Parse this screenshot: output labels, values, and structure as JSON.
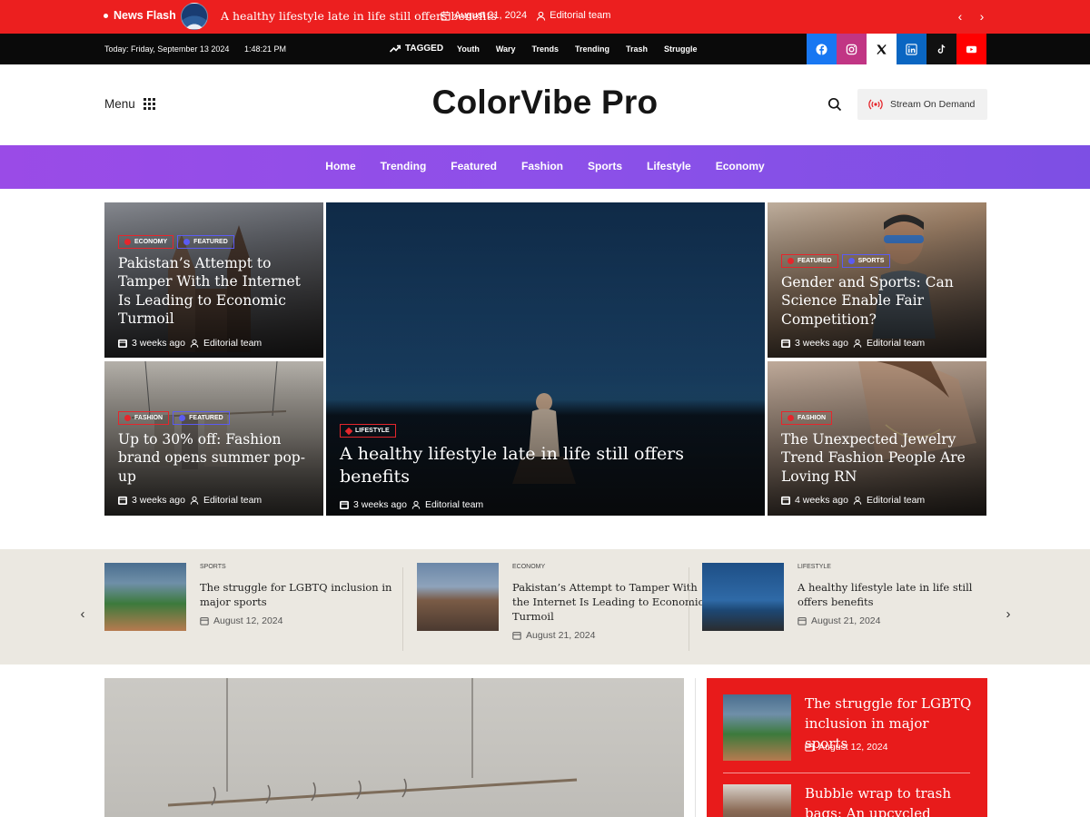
{
  "news_flash": {
    "label": "News Flash",
    "headline": "A healthy lifestyle late in life still offers benefits",
    "date": "August 21, 2024",
    "author": "Editorial team",
    "prev_glyph": "‹",
    "next_glyph": "›"
  },
  "topbar": {
    "date": "Today: Friday, September 13 2024",
    "time": "1:48:21 PM",
    "tagged_label": "TAGGED",
    "tags": [
      "Youth",
      "Wary",
      "Trends",
      "Trending",
      "Trash",
      "Struggle"
    ],
    "socials": [
      {
        "name": "facebook-icon",
        "color": "#1877f2"
      },
      {
        "name": "instagram-icon",
        "color": "#c13584"
      },
      {
        "name": "x-icon",
        "color": "#ffffff"
      },
      {
        "name": "linkedin-icon",
        "color": "#0a66c2"
      },
      {
        "name": "tiktok-icon",
        "color": "#111111"
      },
      {
        "name": "youtube-icon",
        "color": "#ff0000"
      }
    ]
  },
  "header": {
    "menu_label": "Menu",
    "site_title": "ColorVibe Pro",
    "stream_label": "Stream On Demand"
  },
  "nav": {
    "items": [
      "Home",
      "Trending",
      "Featured",
      "Fashion",
      "Sports",
      "Lifestyle",
      "Economy"
    ]
  },
  "hero": {
    "tl": {
      "badges": [
        "ECONOMY",
        "FEATURED"
      ],
      "title": "Pakistan’s Attempt to Tamper With the Internet Is Leading to Economic Turmoil",
      "time": "3 weeks ago",
      "author": "Editorial team"
    },
    "bl": {
      "badges": [
        "FASHION",
        "FEATURED"
      ],
      "title": "Up to 30% off: Fashion brand opens summer pop-up",
      "time": "3 weeks ago",
      "author": "Editorial team"
    },
    "center": {
      "badges": [
        "LIFESTYLE"
      ],
      "title": "A healthy lifestyle late in life still offers benefits",
      "time": "3 weeks ago",
      "author": "Editorial team"
    },
    "tr": {
      "badges": [
        "FEATURED",
        "SPORTS"
      ],
      "title": "Gender and Sports: Can Science Enable Fair Competition?",
      "time": "3 weeks ago",
      "author": "Editorial team"
    },
    "br": {
      "badges": [
        "FASHION"
      ],
      "title": "The Unexpected Jewelry Trend Fashion People Are Loving RN",
      "time": "4 weeks ago",
      "author": "Editorial team"
    }
  },
  "slider": {
    "prev_glyph": "‹",
    "next_glyph": "›",
    "items": [
      {
        "category": "SPORTS",
        "title": "The struggle for LGBTQ inclusion in major sports",
        "date": "August 12, 2024"
      },
      {
        "category": "ECONOMY",
        "title": "Pakistan’s Attempt to Tamper With the Internet Is Leading to Economic Turmoil",
        "date": "August 21, 2024"
      },
      {
        "category": "LIFESTYLE",
        "title": "A healthy lifestyle late in life still offers benefits",
        "date": "August 21, 2024"
      }
    ]
  },
  "side_list": {
    "items": [
      {
        "title": "The struggle for LGBTQ inclusion in major sports",
        "date": "August 12, 2024"
      },
      {
        "title": "Bubble wrap to trash bags: An upcycled fashion sho",
        "date": ""
      }
    ]
  },
  "colors": {
    "brand_red": "#ec1f1f",
    "nav_purple": "#8d50e9",
    "strip_beige": "#ebe8e1"
  }
}
